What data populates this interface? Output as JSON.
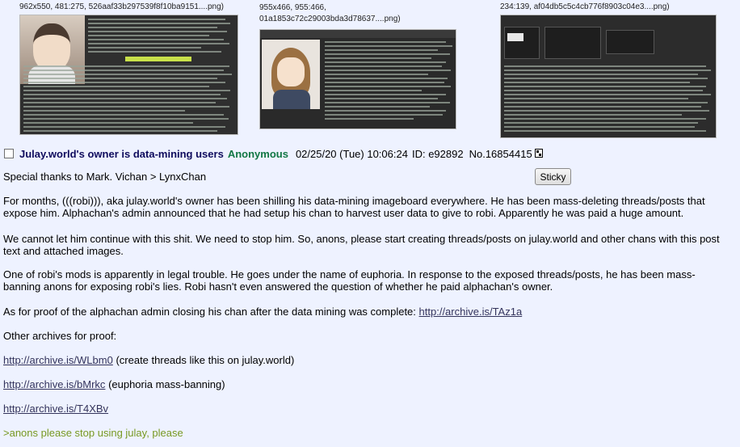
{
  "thumbnails": [
    {
      "info": "962x550, 481:275, 526aaf33b297539f8f10ba9151....png)"
    },
    {
      "info_line1": "955x466, 955:466,",
      "info_line2": "01a1853c72c29003bda3d78637....png)"
    },
    {
      "info": "234:139, af04db5c5c4cb776f8903c04e3....png)"
    }
  ],
  "post": {
    "subject": "Julay.world's owner is data-mining users",
    "name": "Anonymous",
    "datetime": "02/25/20 (Tue) 10:06:24",
    "id_label": "ID:",
    "id_value": "e92892",
    "no_label": "No.",
    "no_value": "16854415",
    "sticky_label": "Sticky",
    "thanks": "Special thanks to Mark. Vichan > LynxChan",
    "para1": "For months, (((robi))), aka julay.world's owner has been shilling his data-mining imageboard everywhere. He has been mass-deleting threads/posts that expose him. Alphachan's admin announced that he had setup his chan to harvest user data to give to robi. Apparently he was paid a huge amount.",
    "para2": "We cannot let him continue with this shit. We need to stop him. So, anons, please start creating threads/posts on julay.world and other chans with this post text and attached images.",
    "para3": "One of robi's mods is apparently in legal trouble. He goes under the name of euphoria. In response to the exposed threads/posts, he has been mass-banning anons for exposing robi's lies. Robi hasn't even answered the question of whether he paid alphachan's owner.",
    "proof_text": "As for proof of the alphachan admin closing his chan after the data mining was complete:",
    "proof_link": "http://archive.is/TAz1a",
    "other_archives": "Other archives for proof:",
    "link1": "http://archive.is/WLbm0",
    "link1_note": "(create threads like this on julay.world)",
    "link2": "http://archive.is/bMrkc",
    "link2_note": "(euphoria mass-banning)",
    "link3": "http://archive.is/T4XBv",
    "greentext": ">anons please stop using julay, please"
  }
}
